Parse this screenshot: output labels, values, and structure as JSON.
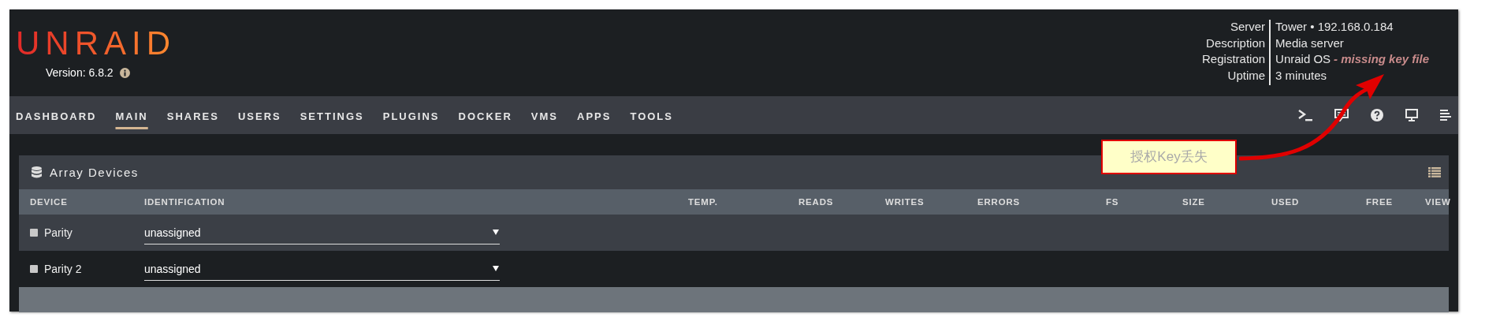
{
  "header": {
    "logo": "UNRAID",
    "version": "Version: 6.8.2",
    "info": [
      {
        "label": "Server",
        "value": "Tower • 192.168.0.184"
      },
      {
        "label": "Description",
        "value": "Media server"
      },
      {
        "label": "Registration",
        "value": "Unraid OS",
        "warning": "- missing key file"
      },
      {
        "label": "Uptime",
        "value": "3 minutes"
      }
    ]
  },
  "nav": {
    "tabs": [
      {
        "label": "DASHBOARD",
        "selected": false
      },
      {
        "label": "MAIN",
        "selected": true
      },
      {
        "label": "SHARES",
        "selected": false
      },
      {
        "label": "USERS",
        "selected": false
      },
      {
        "label": "SETTINGS",
        "selected": false
      },
      {
        "label": "PLUGINS",
        "selected": false
      },
      {
        "label": "DOCKER",
        "selected": false
      },
      {
        "label": "VMS",
        "selected": false
      },
      {
        "label": "APPS",
        "selected": false
      },
      {
        "label": "TOOLS",
        "selected": false
      }
    ]
  },
  "panel": {
    "title": "Array Devices",
    "columns": [
      "DEVICE",
      "IDENTIFICATION",
      "TEMP.",
      "READS",
      "WRITES",
      "ERRORS",
      "FS",
      "SIZE",
      "USED",
      "FREE",
      "VIEW"
    ],
    "rows": [
      {
        "device": "Parity",
        "identification": "unassigned"
      },
      {
        "device": "Parity 2",
        "identification": "unassigned"
      }
    ]
  },
  "annotation": {
    "text": "授权Key丢失"
  }
}
